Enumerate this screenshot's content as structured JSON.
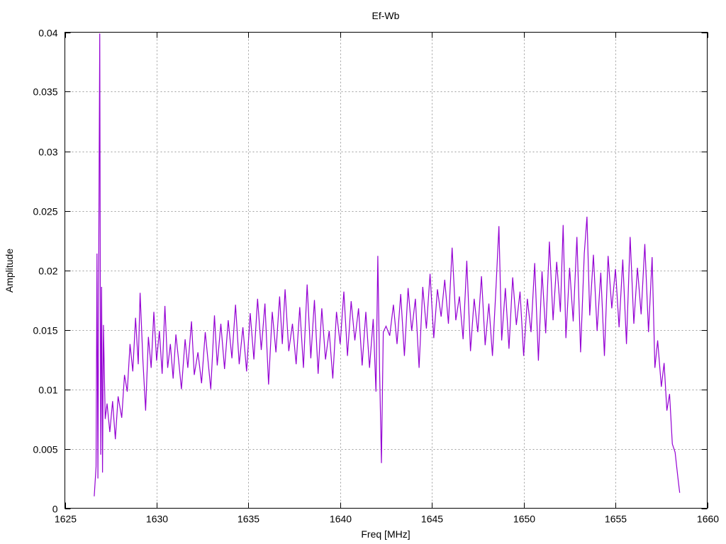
{
  "chart_data": {
    "type": "line",
    "title": "Ef-Wb",
    "xlabel": "Freq [MHz]",
    "ylabel": "Amplitude",
    "xlim": [
      1625,
      1660
    ],
    "ylim": [
      0,
      0.04
    ],
    "grid": true,
    "legend": "none",
    "x_ticks": [
      1625,
      1630,
      1635,
      1640,
      1645,
      1650,
      1655,
      1660
    ],
    "x_tick_labels": [
      "1625",
      "1630",
      "1635",
      "1640",
      "1645",
      "1650",
      "1655",
      "1660"
    ],
    "y_ticks": [
      0,
      0.005,
      0.01,
      0.015,
      0.02,
      0.025,
      0.03,
      0.035,
      0.04
    ],
    "y_tick_labels": [
      "0",
      "0.005",
      "0.01",
      "0.015",
      "0.02",
      "0.025",
      "0.03",
      "0.035",
      "0.04"
    ],
    "series": [
      {
        "name": "Ef-Wb",
        "color": "#9400d3",
        "points": [
          [
            1626.6,
            0.001
          ],
          [
            1626.7,
            0.0035
          ],
          [
            1626.75,
            0.0214
          ],
          [
            1626.8,
            0.0025
          ],
          [
            1626.85,
            0.0228
          ],
          [
            1626.9,
            0.0399
          ],
          [
            1626.95,
            0.0045
          ],
          [
            1627.0,
            0.0186
          ],
          [
            1627.05,
            0.003
          ],
          [
            1627.1,
            0.0154
          ],
          [
            1627.2,
            0.0075
          ],
          [
            1627.3,
            0.0088
          ],
          [
            1627.45,
            0.0064
          ],
          [
            1627.6,
            0.009
          ],
          [
            1627.75,
            0.0058
          ],
          [
            1627.9,
            0.0094
          ],
          [
            1628.1,
            0.0076
          ],
          [
            1628.25,
            0.0112
          ],
          [
            1628.4,
            0.0098
          ],
          [
            1628.55,
            0.0138
          ],
          [
            1628.7,
            0.0115
          ],
          [
            1628.85,
            0.016
          ],
          [
            1629.0,
            0.0121
          ],
          [
            1629.1,
            0.0181
          ],
          [
            1629.25,
            0.0125
          ],
          [
            1629.4,
            0.0082
          ],
          [
            1629.55,
            0.0144
          ],
          [
            1629.7,
            0.0118
          ],
          [
            1629.85,
            0.0165
          ],
          [
            1630.0,
            0.0124
          ],
          [
            1630.15,
            0.0149
          ],
          [
            1630.3,
            0.0113
          ],
          [
            1630.45,
            0.017
          ],
          [
            1630.6,
            0.0118
          ],
          [
            1630.75,
            0.0138
          ],
          [
            1630.9,
            0.0109
          ],
          [
            1631.05,
            0.0146
          ],
          [
            1631.2,
            0.0124
          ],
          [
            1631.35,
            0.01
          ],
          [
            1631.55,
            0.0142
          ],
          [
            1631.7,
            0.0118
          ],
          [
            1631.9,
            0.0157
          ],
          [
            1632.05,
            0.0112
          ],
          [
            1632.25,
            0.0131
          ],
          [
            1632.45,
            0.0105
          ],
          [
            1632.65,
            0.0148
          ],
          [
            1632.8,
            0.0124
          ],
          [
            1632.95,
            0.01
          ],
          [
            1633.15,
            0.0162
          ],
          [
            1633.3,
            0.012
          ],
          [
            1633.5,
            0.0155
          ],
          [
            1633.7,
            0.0117
          ],
          [
            1633.9,
            0.0158
          ],
          [
            1634.1,
            0.0126
          ],
          [
            1634.3,
            0.0171
          ],
          [
            1634.5,
            0.0121
          ],
          [
            1634.7,
            0.0152
          ],
          [
            1634.9,
            0.0115
          ],
          [
            1635.1,
            0.0164
          ],
          [
            1635.3,
            0.0125
          ],
          [
            1635.5,
            0.0176
          ],
          [
            1635.7,
            0.0133
          ],
          [
            1635.9,
            0.0172
          ],
          [
            1636.1,
            0.0104
          ],
          [
            1636.3,
            0.0165
          ],
          [
            1636.5,
            0.0131
          ],
          [
            1636.7,
            0.0178
          ],
          [
            1636.85,
            0.0138
          ],
          [
            1637.0,
            0.0184
          ],
          [
            1637.2,
            0.0132
          ],
          [
            1637.4,
            0.0155
          ],
          [
            1637.6,
            0.0121
          ],
          [
            1637.8,
            0.0169
          ],
          [
            1638.0,
            0.0118
          ],
          [
            1638.2,
            0.0188
          ],
          [
            1638.4,
            0.0126
          ],
          [
            1638.6,
            0.0175
          ],
          [
            1638.8,
            0.0113
          ],
          [
            1639.0,
            0.0168
          ],
          [
            1639.2,
            0.0125
          ],
          [
            1639.4,
            0.0149
          ],
          [
            1639.6,
            0.0109
          ],
          [
            1639.8,
            0.0165
          ],
          [
            1640.0,
            0.0138
          ],
          [
            1640.2,
            0.0182
          ],
          [
            1640.4,
            0.0128
          ],
          [
            1640.6,
            0.0174
          ],
          [
            1640.8,
            0.0141
          ],
          [
            1641.0,
            0.0168
          ],
          [
            1641.2,
            0.012
          ],
          [
            1641.4,
            0.0165
          ],
          [
            1641.6,
            0.0118
          ],
          [
            1641.8,
            0.0159
          ],
          [
            1641.95,
            0.0098
          ],
          [
            1642.05,
            0.0212
          ],
          [
            1642.15,
            0.0116
          ],
          [
            1642.25,
            0.0038
          ],
          [
            1642.35,
            0.0148
          ],
          [
            1642.5,
            0.0153
          ],
          [
            1642.7,
            0.0145
          ],
          [
            1642.9,
            0.0171
          ],
          [
            1643.1,
            0.0138
          ],
          [
            1643.3,
            0.018
          ],
          [
            1643.5,
            0.0128
          ],
          [
            1643.7,
            0.0185
          ],
          [
            1643.9,
            0.0149
          ],
          [
            1644.1,
            0.0176
          ],
          [
            1644.3,
            0.0118
          ],
          [
            1644.5,
            0.0186
          ],
          [
            1644.7,
            0.0151
          ],
          [
            1644.9,
            0.0197
          ],
          [
            1645.1,
            0.0143
          ],
          [
            1645.3,
            0.0184
          ],
          [
            1645.5,
            0.0161
          ],
          [
            1645.7,
            0.0192
          ],
          [
            1645.9,
            0.0155
          ],
          [
            1646.1,
            0.0219
          ],
          [
            1646.3,
            0.0158
          ],
          [
            1646.5,
            0.0178
          ],
          [
            1646.7,
            0.0142
          ],
          [
            1646.9,
            0.0208
          ],
          [
            1647.1,
            0.0132
          ],
          [
            1647.3,
            0.0176
          ],
          [
            1647.5,
            0.0148
          ],
          [
            1647.7,
            0.0195
          ],
          [
            1647.9,
            0.0137
          ],
          [
            1648.1,
            0.0172
          ],
          [
            1648.3,
            0.0128
          ],
          [
            1648.5,
            0.0188
          ],
          [
            1648.65,
            0.0237
          ],
          [
            1648.8,
            0.0141
          ],
          [
            1649.0,
            0.0185
          ],
          [
            1649.2,
            0.0134
          ],
          [
            1649.4,
            0.0194
          ],
          [
            1649.6,
            0.0154
          ],
          [
            1649.8,
            0.0182
          ],
          [
            1650.0,
            0.0128
          ],
          [
            1650.2,
            0.0176
          ],
          [
            1650.4,
            0.0148
          ],
          [
            1650.6,
            0.0206
          ],
          [
            1650.8,
            0.0124
          ],
          [
            1651.0,
            0.0199
          ],
          [
            1651.2,
            0.0147
          ],
          [
            1651.4,
            0.0224
          ],
          [
            1651.6,
            0.0158
          ],
          [
            1651.8,
            0.0207
          ],
          [
            1652.0,
            0.0165
          ],
          [
            1652.15,
            0.0238
          ],
          [
            1652.3,
            0.0143
          ],
          [
            1652.5,
            0.0202
          ],
          [
            1652.7,
            0.0157
          ],
          [
            1652.9,
            0.0228
          ],
          [
            1653.1,
            0.0131
          ],
          [
            1653.3,
            0.0214
          ],
          [
            1653.45,
            0.0245
          ],
          [
            1653.6,
            0.0162
          ],
          [
            1653.8,
            0.0213
          ],
          [
            1654.0,
            0.0149
          ],
          [
            1654.2,
            0.0198
          ],
          [
            1654.4,
            0.0128
          ],
          [
            1654.6,
            0.0212
          ],
          [
            1654.8,
            0.0168
          ],
          [
            1655.0,
            0.0201
          ],
          [
            1655.2,
            0.0152
          ],
          [
            1655.4,
            0.0209
          ],
          [
            1655.6,
            0.0138
          ],
          [
            1655.8,
            0.0228
          ],
          [
            1656.0,
            0.0155
          ],
          [
            1656.2,
            0.0202
          ],
          [
            1656.4,
            0.0163
          ],
          [
            1656.6,
            0.0222
          ],
          [
            1656.8,
            0.0148
          ],
          [
            1657.0,
            0.0211
          ],
          [
            1657.15,
            0.0118
          ],
          [
            1657.3,
            0.0141
          ],
          [
            1657.5,
            0.0102
          ],
          [
            1657.65,
            0.0122
          ],
          [
            1657.8,
            0.0082
          ],
          [
            1657.95,
            0.0096
          ],
          [
            1658.1,
            0.0054
          ],
          [
            1658.25,
            0.0047
          ],
          [
            1658.4,
            0.0026
          ],
          [
            1658.5,
            0.0013
          ]
        ]
      }
    ]
  }
}
